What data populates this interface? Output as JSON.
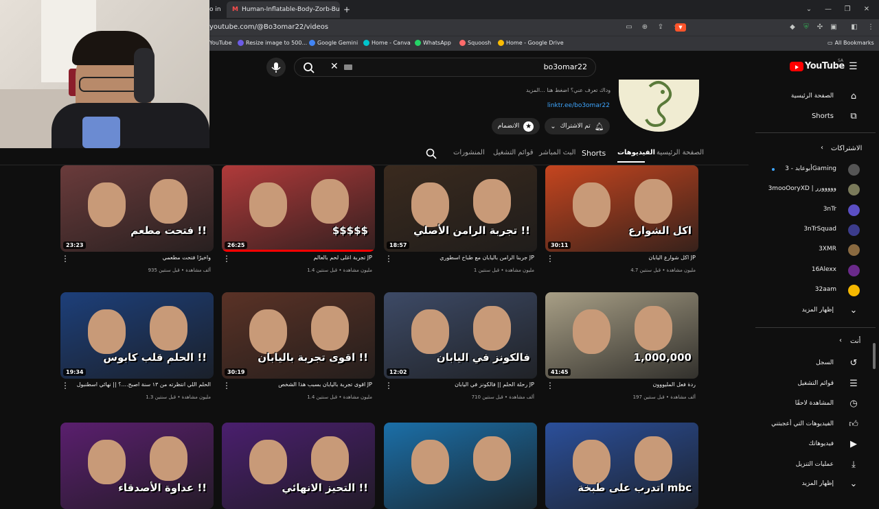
{
  "browser": {
    "tabs": [
      {
        "label": "o in"
      },
      {
        "label": "Human-Inflatable-Body-Zorb-Bubble"
      }
    ],
    "new_tab": "+",
    "url": "youtube.com/@Bo3omar22/videos",
    "bookmarks": [
      {
        "label": "YouTube",
        "color": "#ff0000"
      },
      {
        "label": "Resize image to 500...",
        "color": "#6c5ce7"
      },
      {
        "label": "Google Gemini",
        "color": "#4285f4"
      },
      {
        "label": "Home - Canva",
        "color": "#00c4cc"
      },
      {
        "label": "WhatsApp",
        "color": "#25d366"
      },
      {
        "label": "Squoosh",
        "color": "#ff6b6b"
      },
      {
        "label": "Home - Google Drive",
        "color": "#fbbc04"
      }
    ],
    "all_bookmarks": "All Bookmarks"
  },
  "topbar": {
    "search_value": "bo3omar22",
    "logo_text": "YouTube",
    "region": "SA"
  },
  "channel": {
    "description": "وداك تعرف عني؟ اضغط هنا ...المزيد",
    "link": "linktr.ee/bo3omar22",
    "subscribed_label": "تم الاشتراك",
    "join_label": "الانضمام",
    "tabs": [
      {
        "label": "الصفحة الرئيسية",
        "active": false
      },
      {
        "label": "الفيديوهات",
        "active": true
      },
      {
        "label": "Shorts",
        "active": false
      },
      {
        "label": "البث المباشر",
        "active": false
      },
      {
        "label": "قوائم التشغيل",
        "active": false
      },
      {
        "label": "المنشورات",
        "active": false
      }
    ]
  },
  "sidebar": {
    "home": "الصفحة الرئيسية",
    "shorts": "Shorts",
    "subscriptions_title": "الاشتراكات",
    "subscriptions": [
      {
        "label": "أبوعابد - 3Gaming",
        "color": "#555"
      },
      {
        "label": "3mooOoryXD | ووووورر",
        "color": "#7a7a5a"
      },
      {
        "label": "3nTr",
        "color": "#5b4fc4"
      },
      {
        "label": "3nTrSquad",
        "color": "#3c3c8c"
      },
      {
        "label": "3XMR",
        "color": "#8a6a40"
      },
      {
        "label": "16Alexx",
        "color": "#6a2a8a"
      },
      {
        "label": "32aam",
        "color": "#f5b800"
      }
    ],
    "show_more_subs": "إظهار المزيد",
    "you_title": "أنت",
    "you_items": [
      {
        "label": "السجل",
        "icon": "history-icon"
      },
      {
        "label": "قوائم التشغيل",
        "icon": "playlist-icon"
      },
      {
        "label": "المشاهدة لاحقًا",
        "icon": "watch-later-icon"
      },
      {
        "label": "الفيديوهات التي أعجبتني",
        "icon": "like-icon"
      },
      {
        "label": "فيديوهاتك",
        "icon": "your-videos-icon"
      },
      {
        "label": "عمليات التنزيل",
        "icon": "download-icon"
      }
    ],
    "show_more_you": "إظهار المزيد"
  },
  "videos": [
    {
      "title": "اكل شوارع اليابان JP",
      "meta": "4.7 مليون مشاهدة • قبل سنتين",
      "duration": "30:11",
      "overlay": "اكل الشوارع",
      "bg": "#c5451f"
    },
    {
      "title": "جربنا الرامن باليابان مع طباخ اسطوري JP",
      "meta": "1 مليون مشاهدة • قبل سنتين",
      "duration": "18:57",
      "overlay": "تجربة الرامن الأصلي !!",
      "bg": "#3a2a1e"
    },
    {
      "title": "تجربة اغلى لحم بالعالم JP",
      "meta": "1.4 مليون مشاهدة • قبل سنتين",
      "duration": "26:25",
      "overlay": "$$$$$",
      "bg": "#b03a3a",
      "progress": 1.0
    },
    {
      "title": "واخيرًا فتحت مطعمي",
      "meta": "935 ألف مشاهدة • قبل سنتين",
      "duration": "23:23",
      "overlay": "فتحت مطعم !!",
      "bg": "#6a3b3b"
    },
    {
      "title": "ردة فعل المليووون",
      "meta": "197 ألف مشاهدة • قبل سنتين",
      "duration": "41:45",
      "overlay": "1,000,000",
      "bg": "#a89f86"
    },
    {
      "title": "رحلة الحلم || فالكونز في اليابان JP",
      "meta": "710 ألف مشاهدة • قبل سنتين",
      "duration": "12:02",
      "overlay": "فالكونز في اليابان",
      "bg": "#3d4a66"
    },
    {
      "title": "اقوى تجربة باليابان بسبب هذا الشخص JP",
      "meta": "1.4 مليون مشاهدة • قبل سنتين",
      "duration": "30:19",
      "overlay": "اقوى تجربة باليابان !!",
      "bg": "#5a3226"
    },
    {
      "title": "الحلم اللي انتظرته من ١٣ سنة اصبح....؟ || نهائي اسطنبول",
      "meta": "1.3 مليون مشاهدة • قبل سنتين",
      "duration": "19:34",
      "overlay": "الحلم قلب كابوس !!",
      "bg": "#1d3f7a"
    },
    {
      "title": "",
      "meta": "",
      "duration": "",
      "overlay": "اتدرب على طبخة mbc",
      "bg": "#2b4f9a"
    },
    {
      "title": "",
      "meta": "",
      "duration": "",
      "overlay": "",
      "bg": "#1b6fa8"
    },
    {
      "title": "",
      "meta": "",
      "duration": "",
      "overlay": "التحيز الانهائي !!",
      "bg": "#4a1f6e"
    },
    {
      "title": "",
      "meta": "",
      "duration": "",
      "overlay": "عداوة الأصدقاء !!",
      "bg": "#5a1f6e"
    }
  ]
}
